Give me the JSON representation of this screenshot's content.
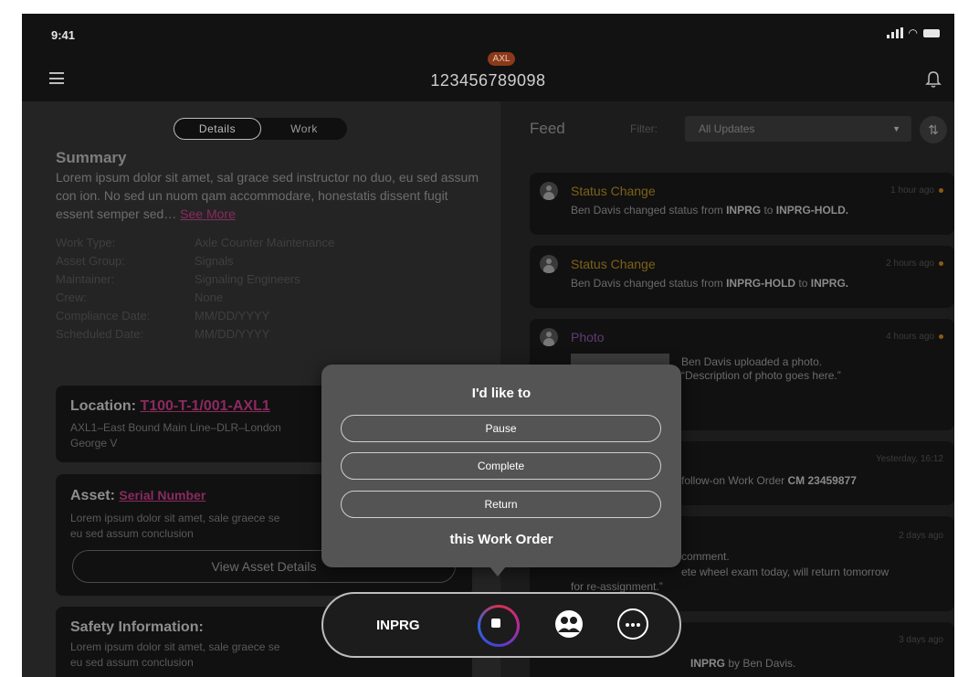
{
  "status_bar": {
    "time": "9:41"
  },
  "header": {
    "badge": "AXL",
    "work_order_number": "123456789098"
  },
  "tabs": {
    "details": "Details",
    "work": "Work"
  },
  "summary": {
    "title": "Summary",
    "text": "Lorem ipsum dolor sit amet, sal grace sed instructor no duo, eu sed assum con ion. No sed un nuom qam accommodare, honestatis dissent fugit essent semper sed… ",
    "see_more": "See More"
  },
  "fields": [
    {
      "label": "Work Type:",
      "value": "Axle Counter Maintenance"
    },
    {
      "label": "Asset Group:",
      "value": "Signals"
    },
    {
      "label": "Maintainer:",
      "value": "Signaling Engineers"
    },
    {
      "label": "Crew:",
      "value": "None"
    },
    {
      "label": "Compliance Date:",
      "value": "MM/DD/YYYY"
    },
    {
      "label": "Scheduled Date:",
      "value": "MM/DD/YYYY"
    }
  ],
  "location": {
    "label": "Location:",
    "link": "T100-T-1/001-AXL1",
    "text": "AXL1–East Bound Main Line–DLR–London",
    "text2": "George V"
  },
  "asset": {
    "label": "Asset:",
    "link": "Serial Number",
    "text": "Lorem ipsum dolor sit amet, sale graece se",
    "text2": "eu sed assum conclusion",
    "button": "View Asset Details"
  },
  "safety": {
    "label": "Safety Information:",
    "text": "Lorem ipsum dolor sit amet, sale graece se",
    "text2": "eu sed assum conclusion"
  },
  "feed": {
    "title": "Feed",
    "filter_label": "Filter:",
    "filter_value": "All Updates",
    "items": [
      {
        "title": "Status Change",
        "time": "1 hour ago",
        "body_a": "Ben Davis changed status from ",
        "body_b": "INPRG",
        "body_c": " to ",
        "body_d": "INPRG-HOLD."
      },
      {
        "title": "Status Change",
        "time": "2 hours ago",
        "body_a": "Ben Davis changed status from ",
        "body_b": "INPRG-HOLD",
        "body_c": " to ",
        "body_d": "INPRG."
      },
      {
        "title": "Photo",
        "time": "4 hours ago",
        "line1": "Ben Davis uploaded a photo.",
        "line2": "“Description of photo goes here.”"
      },
      {
        "time": "Yesterday, 16:12",
        "body_a": "follow-on Work Order ",
        "body_b": "CM 23459877"
      },
      {
        "time": "2 days ago",
        "line1": "comment.",
        "line2": "ete wheel exam today, will return tomorrow",
        "line3": "for re-assignment.”"
      },
      {
        "time": "3 days ago",
        "body_a": "INPRG",
        "body_b": " by Ben Davis."
      }
    ]
  },
  "action_sheet": {
    "heading": "I'd like to",
    "options": [
      "Pause",
      "Complete",
      "Return"
    ],
    "footer": "this Work Order"
  },
  "action_bar": {
    "status": "INPRG"
  },
  "colors": {
    "accent_gold": "#7e6116",
    "link_magenta": "#8b2a5f",
    "modal": "#545454"
  }
}
